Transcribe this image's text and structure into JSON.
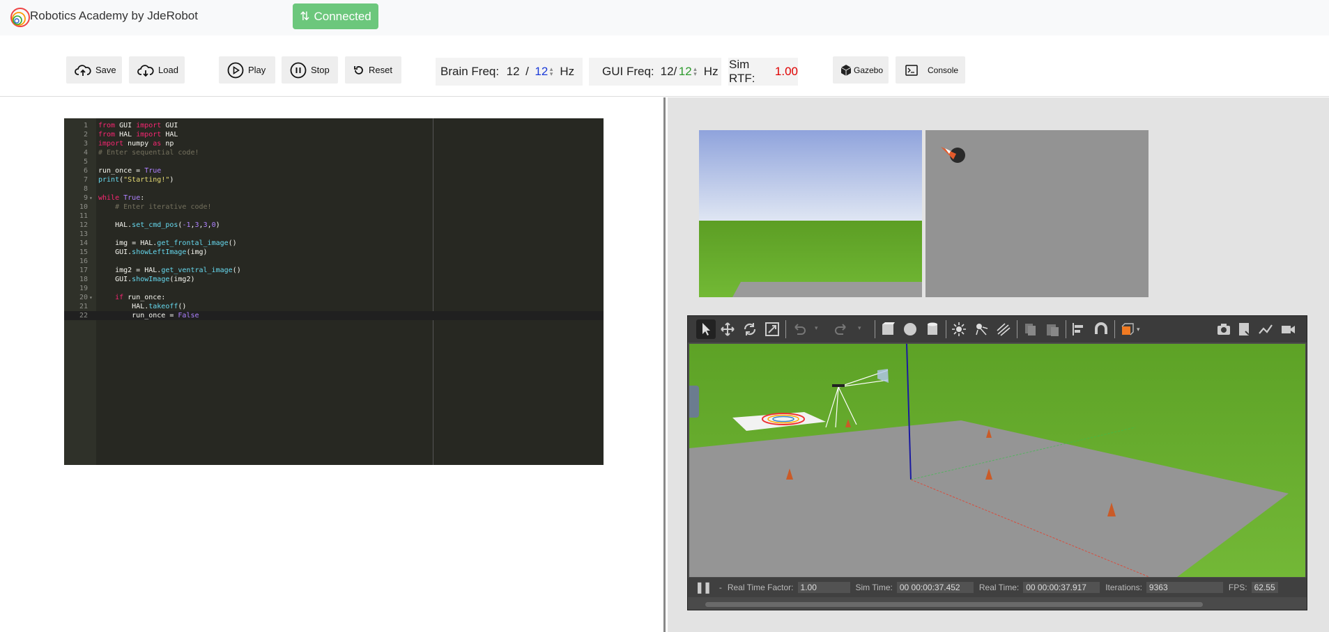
{
  "app": {
    "title": "Robotics Academy by JdeRobot",
    "status_button": "Connected"
  },
  "toolbar": {
    "save": "Save",
    "load": "Load",
    "play": "Play",
    "stop": "Stop",
    "reset": "Reset",
    "brain_freq_label": "Brain Freq:",
    "brain_freq_value": "12",
    "brain_freq_sep": "/",
    "brain_freq_target": "12",
    "brain_freq_unit": "Hz",
    "gui_freq_label": "GUI Freq:",
    "gui_freq_value": "12/",
    "gui_freq_target": "12",
    "gui_freq_unit": "Hz",
    "sim_rtf_label": "Sim RTF:",
    "sim_rtf_value": "1.00",
    "gazebo": "Gazebo",
    "console": "Console"
  },
  "editor": {
    "active_line": 22,
    "lines": [
      {
        "n": "1",
        "code": "from GUI import GUI"
      },
      {
        "n": "2",
        "code": "from HAL import HAL"
      },
      {
        "n": "3",
        "code": "import numpy as np"
      },
      {
        "n": "4",
        "code": "# Enter sequential code!"
      },
      {
        "n": "5",
        "code": ""
      },
      {
        "n": "6",
        "code": "run_once = True"
      },
      {
        "n": "7",
        "code": "print(\"Starting!\")"
      },
      {
        "n": "8",
        "code": ""
      },
      {
        "n": "9",
        "code": "while True:"
      },
      {
        "n": "10",
        "code": "    # Enter iterative code!"
      },
      {
        "n": "11",
        "code": ""
      },
      {
        "n": "12",
        "code": "    HAL.set_cmd_pos(-1,3,3,0)"
      },
      {
        "n": "13",
        "code": ""
      },
      {
        "n": "14",
        "code": "    img = HAL.get_frontal_image()"
      },
      {
        "n": "15",
        "code": "    GUI.showLeftImage(img)"
      },
      {
        "n": "16",
        "code": ""
      },
      {
        "n": "17",
        "code": "    img2 = HAL.get_ventral_image()"
      },
      {
        "n": "18",
        "code": "    GUI.showImage(img2)"
      },
      {
        "n": "19",
        "code": ""
      },
      {
        "n": "20",
        "code": "    if run_once:"
      },
      {
        "n": "21",
        "code": "        HAL.takeoff()"
      },
      {
        "n": "22",
        "code": "        run_once = False"
      }
    ]
  },
  "gazebo": {
    "rtf_label": "Real Time Factor:",
    "rtf_value": "1.00",
    "sim_time_label": "Sim Time:",
    "sim_time_value": "00 00:00:37.452",
    "real_time_label": "Real Time:",
    "real_time_value": "00 00:00:37.917",
    "iterations_label": "Iterations:",
    "iterations_value": "9363",
    "fps_label": "FPS:",
    "fps_value": "62.55"
  },
  "colors": {
    "connected": "#6cc77c",
    "rtf_red": "#e00000",
    "brain_blue": "#1a3ad8",
    "gui_green": "#2c9a2c"
  }
}
